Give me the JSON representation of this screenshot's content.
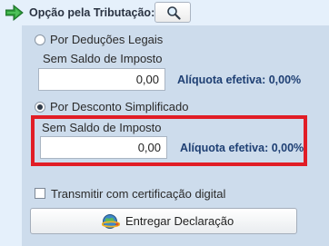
{
  "header": {
    "title": "Opção pela Tributação:",
    "arrow_icon": "green-right-arrow-icon",
    "search_icon": "magnifier-icon"
  },
  "options": [
    {
      "label": "Por Deduções Legais",
      "selected": false,
      "balance_label": "Sem Saldo de Imposto",
      "value": "0,00",
      "rate_text": "Alíquota efetiva: 0,00%"
    },
    {
      "label": "Por Desconto Simplificado",
      "selected": true,
      "balance_label": "Sem Saldo de Imposto",
      "value": "0,00",
      "rate_text": "Alíquota efetiva: 0,00%"
    }
  ],
  "certificate": {
    "label": "Transmitir com certificação digital",
    "checked": false
  },
  "submit": {
    "label": "Entregar Declaração",
    "icon": "globe-send-icon"
  },
  "colors": {
    "background": "#e5f0fb",
    "panel": "#cddcec",
    "highlight": "#e11d26",
    "rate_text": "#1e3f73"
  }
}
